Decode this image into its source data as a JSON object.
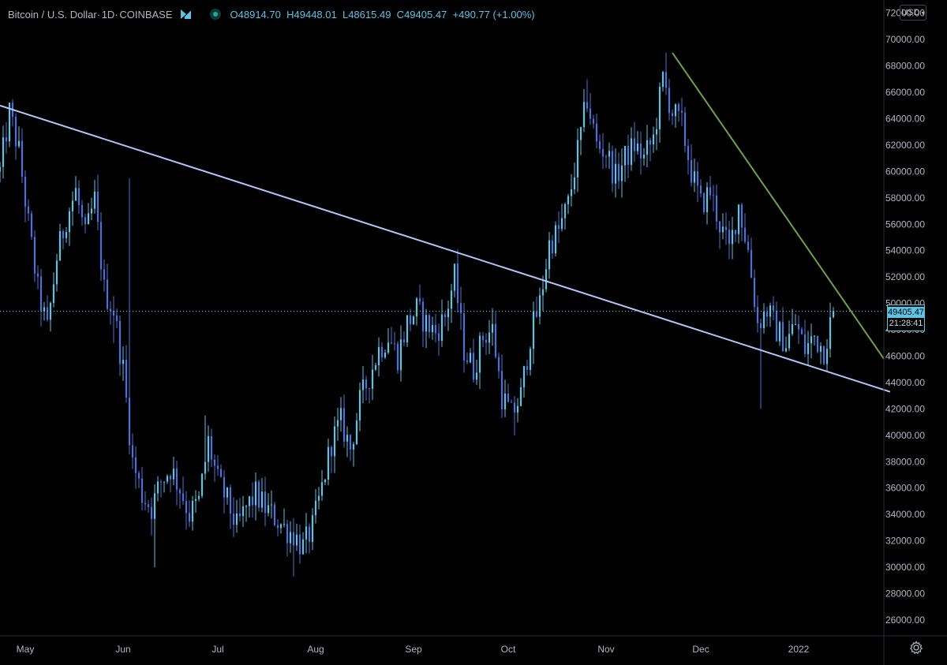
{
  "header": {
    "symbol": "Bitcoin / U.S. Dollar",
    "interval": "1D",
    "exchange": "COINBASE",
    "open_label": "O",
    "open": "48914.70",
    "high_label": "H",
    "high": "49448.01",
    "low_label": "L",
    "low": "48615.49",
    "close_label": "C",
    "close": "49405.47",
    "change": "+490.77 (+1.00%)"
  },
  "currency": "USD",
  "price_label": {
    "price": "49405.47",
    "countdown": "21:28:41"
  },
  "icons": {
    "flag": "flag-icon",
    "status": "market-status-icon",
    "settings": "gear-icon",
    "dropdown": "chevron-down-icon"
  },
  "colors": {
    "up": "#5bc4e5",
    "down": "#4a72d8",
    "trendline_main": "#b4c6f8",
    "trendline_green": "#6fa24a",
    "background": "#000000"
  },
  "chart_data": {
    "type": "candlestick",
    "title": "Bitcoin / U.S. Dollar · 1D · COINBASE",
    "yticks": [
      26000,
      28000,
      30000,
      32000,
      34000,
      36000,
      38000,
      40000,
      42000,
      44000,
      46000,
      48000,
      50000,
      52000,
      54000,
      56000,
      58000,
      60000,
      62000,
      64000,
      66000,
      68000,
      70000,
      72000
    ],
    "ylim": [
      24800,
      73000
    ],
    "xticks": [
      "May",
      "Jun",
      "Jul",
      "Aug",
      "Sep",
      "Oct",
      "Nov",
      "Dec",
      "2022"
    ],
    "xlim_days": [
      0,
      280
    ],
    "xtick_days": [
      8,
      39,
      69,
      100,
      131,
      161,
      192,
      222,
      253
    ],
    "current_price": 49405.47,
    "close_path": [
      [
        0,
        60000
      ],
      [
        3,
        64500
      ],
      [
        6,
        61500
      ],
      [
        9,
        56000
      ],
      [
        12,
        51000
      ],
      [
        15,
        48000
      ],
      [
        18,
        53500
      ],
      [
        21,
        56500
      ],
      [
        24,
        58500
      ],
      [
        27,
        55000
      ],
      [
        30,
        57800
      ],
      [
        33,
        51000
      ],
      [
        36,
        49500
      ],
      [
        39,
        45000
      ],
      [
        42,
        38000
      ],
      [
        45,
        35500
      ],
      [
        48,
        34500
      ],
      [
        51,
        36500
      ],
      [
        54,
        37500
      ],
      [
        57,
        36000
      ],
      [
        60,
        34000
      ],
      [
        63,
        35000
      ],
      [
        66,
        39500
      ],
      [
        69,
        36500
      ],
      [
        72,
        35000
      ],
      [
        75,
        33000
      ],
      [
        78,
        34500
      ],
      [
        81,
        35500
      ],
      [
        84,
        34500
      ],
      [
        87,
        33800
      ],
      [
        90,
        33000
      ],
      [
        93,
        32500
      ],
      [
        96,
        31500
      ],
      [
        99,
        33000
      ],
      [
        102,
        36000
      ],
      [
        105,
        39500
      ],
      [
        108,
        41000
      ],
      [
        111,
        39000
      ],
      [
        114,
        42500
      ],
      [
        117,
        44500
      ],
      [
        120,
        46500
      ],
      [
        123,
        47500
      ],
      [
        126,
        46000
      ],
      [
        129,
        48500
      ],
      [
        132,
        49500
      ],
      [
        135,
        48500
      ],
      [
        138,
        47800
      ],
      [
        141,
        49000
      ],
      [
        144,
        52000
      ],
      [
        147,
        46500
      ],
      [
        150,
        45000
      ],
      [
        153,
        47500
      ],
      [
        156,
        48000
      ],
      [
        159,
        43000
      ],
      [
        162,
        41500
      ],
      [
        165,
        43000
      ],
      [
        168,
        47500
      ],
      [
        171,
        50000
      ],
      [
        174,
        54500
      ],
      [
        177,
        55500
      ],
      [
        180,
        57500
      ],
      [
        183,
        61500
      ],
      [
        186,
        65500
      ],
      [
        189,
        62000
      ],
      [
        192,
        61500
      ],
      [
        195,
        59500
      ],
      [
        198,
        61000
      ],
      [
        201,
        62000
      ],
      [
        204,
        61000
      ],
      [
        207,
        62500
      ],
      [
        210,
        67000
      ],
      [
        213,
        64500
      ],
      [
        216,
        63500
      ],
      [
        219,
        60000
      ],
      [
        222,
        57500
      ],
      [
        225,
        58500
      ],
      [
        228,
        56000
      ],
      [
        231,
        54000
      ],
      [
        234,
        57500
      ],
      [
        237,
        54000
      ],
      [
        240,
        48500
      ],
      [
        243,
        49500
      ],
      [
        246,
        48000
      ],
      [
        249,
        47000
      ],
      [
        252,
        48500
      ],
      [
        255,
        46500
      ],
      [
        258,
        47500
      ],
      [
        261,
        46500
      ],
      [
        264,
        49400
      ]
    ],
    "key_levels": [
      {
        "day": 3,
        "high": 65000
      },
      {
        "day": 36,
        "low": 47000
      },
      {
        "day": 41,
        "high": 59500
      },
      {
        "day": 49,
        "low": 30000
      },
      {
        "day": 65,
        "high": 41500
      },
      {
        "day": 93,
        "low": 29300
      },
      {
        "day": 144,
        "high": 53000
      },
      {
        "day": 163,
        "low": 40000
      },
      {
        "day": 186,
        "high": 67000
      },
      {
        "day": 211,
        "high": 69000
      },
      {
        "day": 241,
        "low": 42000
      }
    ],
    "trendlines": [
      {
        "name": "",
        "color": "#b4c6f8",
        "start": [
          0,
          65000
        ],
        "end": [
          282,
          43300
        ]
      },
      {
        "name": "",
        "color": "#6fa24a",
        "start": [
          213,
          69000
        ],
        "end": [
          280,
          45800
        ]
      }
    ],
    "grid": false,
    "legend": "none"
  }
}
